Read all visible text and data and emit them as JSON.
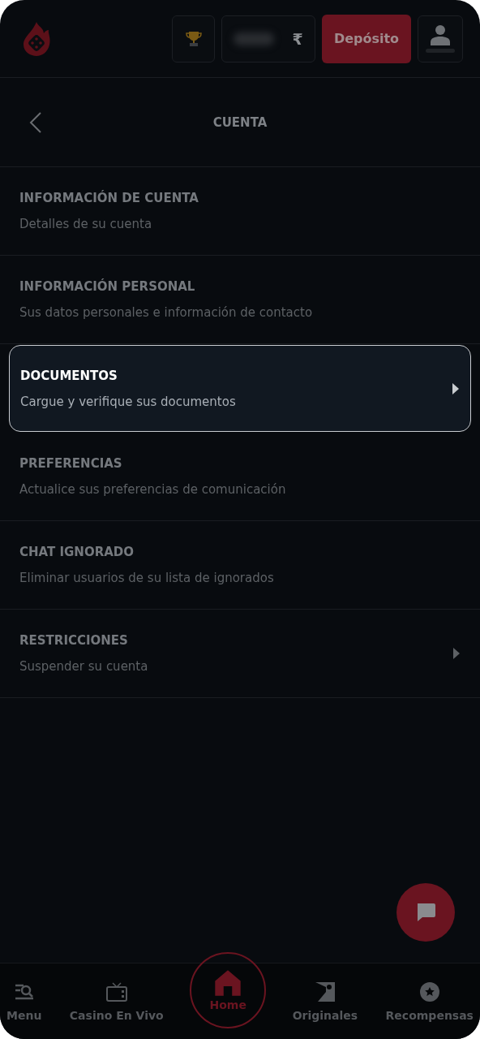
{
  "header": {
    "deposit_button": "Depósito",
    "currency": "₹"
  },
  "page": {
    "title": "CUENTA"
  },
  "items": [
    {
      "title": "INFORMACIÓN DE CUENTA",
      "subtitle": "Detalles de su cuenta",
      "selected": false,
      "arrow": false
    },
    {
      "title": "INFORMACIÓN PERSONAL",
      "subtitle": "Sus datos personales e información de contacto",
      "selected": false,
      "arrow": false
    },
    {
      "title": "DOCUMENTOS",
      "subtitle": "Cargue y verifique sus documentos",
      "selected": true,
      "arrow": true
    },
    {
      "title": "PREFERENCIAS",
      "subtitle": "Actualice sus preferencias de comunicación",
      "selected": false,
      "arrow": false
    },
    {
      "title": "CHAT IGNORADO",
      "subtitle": "Eliminar usuarios de su lista de ignorados",
      "selected": false,
      "arrow": false
    },
    {
      "title": "RESTRICCIONES",
      "subtitle": "Suspender su cuenta",
      "selected": false,
      "arrow": true
    }
  ],
  "nav": [
    {
      "label": "Menu",
      "kind": "menu",
      "selected": false
    },
    {
      "label": "Casino En Vivo",
      "kind": "tv",
      "selected": false
    },
    {
      "label": "Home",
      "kind": "home",
      "selected": true
    },
    {
      "label": "Originales",
      "kind": "originals",
      "selected": false
    },
    {
      "label": "Recompensas",
      "kind": "rewards",
      "selected": false
    }
  ]
}
